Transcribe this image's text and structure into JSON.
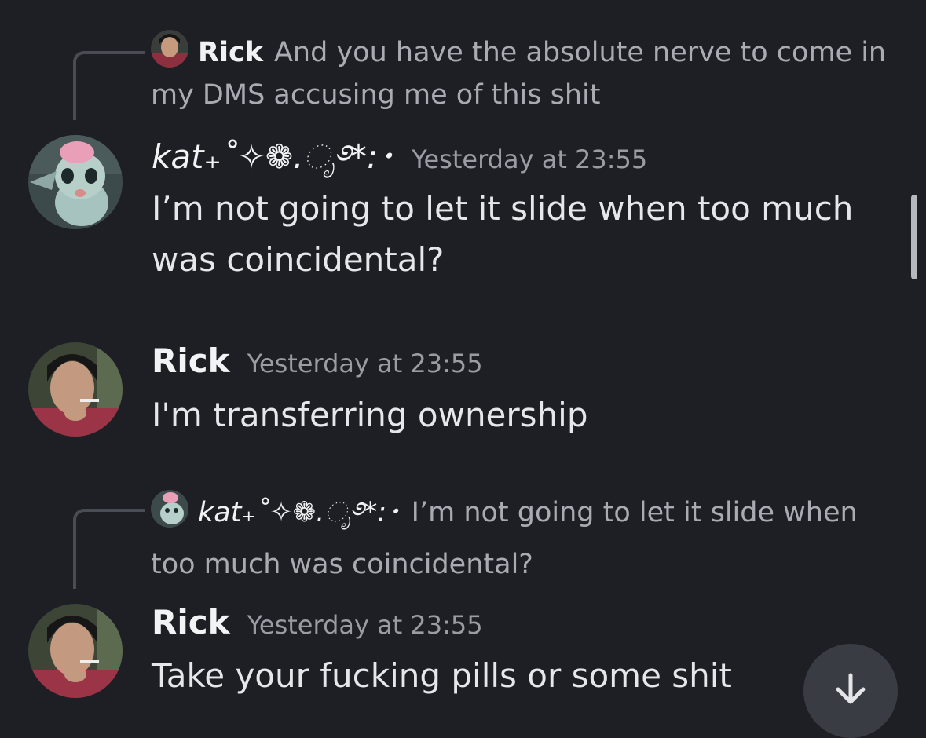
{
  "messages": [
    {
      "reply": {
        "author": "Rick",
        "text": "And you have the absolute nerve to come in my DMS accusing me of this shit"
      },
      "author": "kat₊˚✧❁.ೃ࿔*:･",
      "timestamp": "Yesterday at 23:55",
      "text": "I’m not going to let it slide when too much was coincidental?"
    },
    {
      "author": "Rick",
      "timestamp": "Yesterday at 23:55",
      "text": "I'm transferring ownership"
    },
    {
      "reply": {
        "author": "kat₊˚✧❁.ೃ࿔*:･",
        "text": "I’m not going to let it slide when too much was coincidental?"
      },
      "author": "Rick",
      "timestamp": "Yesterday at 23:55",
      "text": "Take your fucking pills or some shit"
    }
  ],
  "icons": {
    "jump_to_present": "arrow-down-icon"
  },
  "colors": {
    "background": "#1e1f24",
    "author": "#f2f3f5",
    "timestamp": "#9a9ca4",
    "reply_text": "#a9abb3",
    "jump_button": "#3a3c43"
  }
}
